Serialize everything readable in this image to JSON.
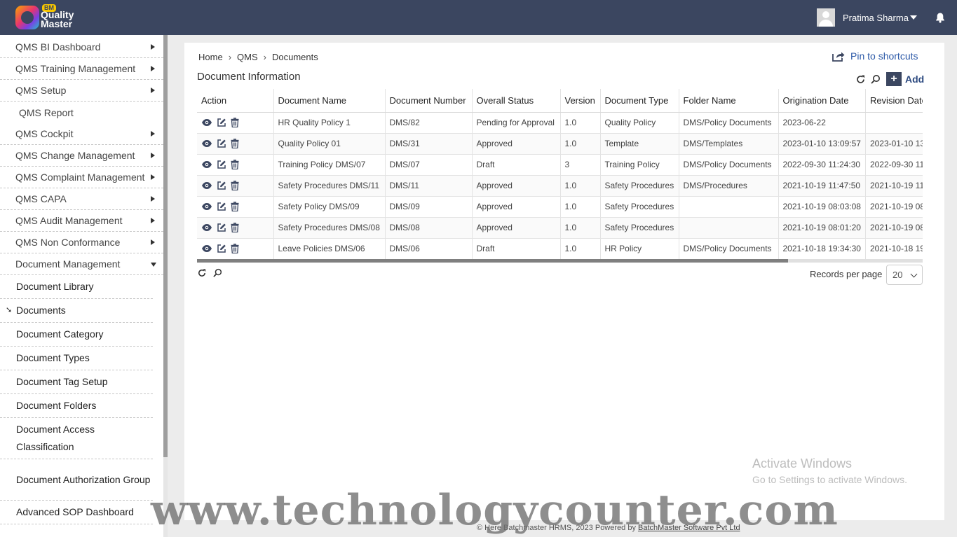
{
  "header": {
    "logo": {
      "badge": "BM",
      "line1": "Quality",
      "line2": "Master"
    },
    "user_name": "Pratima Sharma",
    "icons": {
      "bell": "bell-icon",
      "avatar": "user-avatar"
    }
  },
  "sidebar": {
    "menus": [
      {
        "label": "QMS BI Dashboard",
        "arrow": "right"
      },
      {
        "label": "QMS Training Management",
        "arrow": "right"
      },
      {
        "label": "QMS Setup",
        "arrow": "right"
      },
      {
        "label": "QMS Report",
        "arrow": "none"
      },
      {
        "label": "QMS Cockpit",
        "arrow": "right"
      },
      {
        "label": "QMS Change Management",
        "arrow": "right"
      },
      {
        "label": "QMS Complaint Management",
        "arrow": "right"
      },
      {
        "label": "QMS CAPA",
        "arrow": "right"
      },
      {
        "label": "QMS Audit Management",
        "arrow": "right"
      },
      {
        "label": "QMS Non Conformance",
        "arrow": "right"
      },
      {
        "label": "Document Management",
        "arrow": "down"
      }
    ],
    "submenu": [
      {
        "label": "Document Library"
      },
      {
        "label": "Documents",
        "active": true
      },
      {
        "label": "Document Category"
      },
      {
        "label": "Document Types"
      },
      {
        "label": "Document Tag Setup"
      },
      {
        "label": "Document Folders"
      },
      {
        "label": "Document Access Classification"
      },
      {
        "label": "Document Authorization Group"
      },
      {
        "label": "Advanced SOP Dashboard"
      }
    ]
  },
  "breadcrumb": [
    "Home",
    "QMS",
    "Documents"
  ],
  "pin_label": "Pin to shortcuts",
  "section_title": "Document Information",
  "add_label": "Add",
  "table": {
    "columns": [
      "Action",
      "Document Name",
      "Document Number",
      "Overall Status",
      "Version",
      "Document Type",
      "Folder Name",
      "Origination Date",
      "Revision Date"
    ],
    "rows": [
      [
        "HR Quality Policy 1",
        "DMS/82",
        "Pending for Approval",
        "1.0",
        "Quality Policy",
        "DMS/Policy Documents",
        "2023-06-22",
        ""
      ],
      [
        "Quality Policy 01",
        "DMS/31",
        "Approved",
        "1.0",
        "Template",
        "DMS/Templates",
        "2023-01-10 13:09:57",
        "2023-01-10 13"
      ],
      [
        "Training Policy DMS/07",
        "DMS/07",
        "Draft",
        "3",
        "Training Policy",
        "DMS/Policy Documents",
        "2022-09-30 11:24:30",
        "2022-09-30 11"
      ],
      [
        "Safety Procedures DMS/11",
        "DMS/11",
        "Approved",
        "1.0",
        "Safety Procedures",
        "DMS/Procedures",
        "2021-10-19 11:47:50",
        "2021-10-19 11"
      ],
      [
        "Safety Policy DMS/09",
        "DMS/09",
        "Approved",
        "1.0",
        "Safety Procedures",
        "",
        "2021-10-19 08:03:08",
        "2021-10-19 08"
      ],
      [
        "Safety Procedures DMS/08",
        "DMS/08",
        "Approved",
        "1.0",
        "Safety Procedures",
        "",
        "2021-10-19 08:01:20",
        "2021-10-19 08"
      ],
      [
        "Leave Policies DMS/06",
        "DMS/06",
        "Draft",
        "1.0",
        "HR Policy",
        "DMS/Policy Documents",
        "2021-10-18 19:34:30",
        "2021-10-18 19"
      ]
    ]
  },
  "records_per_page_label": "Records per page",
  "records_per_page_value": "20",
  "activate": {
    "line1": "Activate Windows",
    "line2": "Go to Settings to activate Windows."
  },
  "footer": {
    "text": "© Here Batchmaster HRMS, 2023  Powered by ",
    "link": "BatchMaster Software Pvt Ltd"
  },
  "watermark": "www.technologycounter.com",
  "colors": {
    "header": "#3b4660",
    "link": "#2d5aa8",
    "accent": "#2d4a80"
  }
}
